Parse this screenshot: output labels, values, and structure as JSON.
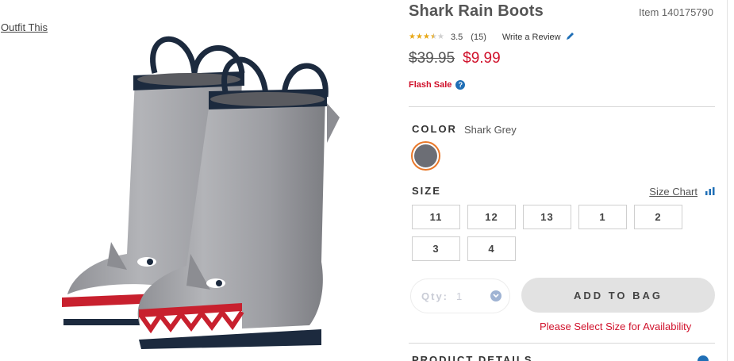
{
  "outfit_link": "Outfit This",
  "product": {
    "title": "Shark Rain Boots",
    "item_number": "Item 140175790",
    "rating": {
      "value": "3.5",
      "stars": 3.5,
      "count": "(15)",
      "write_review": "Write a Review"
    },
    "price": {
      "original": "$39.95",
      "sale": "$9.99"
    },
    "flash_sale": "Flash Sale",
    "info_icon": "?"
  },
  "color": {
    "label": "COLOR",
    "value": "Shark Grey",
    "swatch_color": "#6c6e75"
  },
  "size": {
    "label": "SIZE",
    "chart_link": "Size Chart",
    "options": [
      "11",
      "12",
      "13",
      "1",
      "2",
      "3",
      "4"
    ]
  },
  "quantity": {
    "label": "Qty:",
    "value": "1"
  },
  "add_to_bag": "ADD TO BAG",
  "size_warning": "Please Select Size for Availability",
  "details": {
    "heading": "PRODUCT DETAILS"
  },
  "colors": {
    "sale_red": "#d0112b",
    "star": "#e8a817",
    "link_blue": "#1f6fb6",
    "swatch_border": "#e8782a"
  },
  "icons": {
    "rating": "star-icon",
    "review": "pencil-icon",
    "size_chart": "bar-chart-icon",
    "qty": "chevron-down-icon",
    "details": "plus-circle-icon"
  }
}
